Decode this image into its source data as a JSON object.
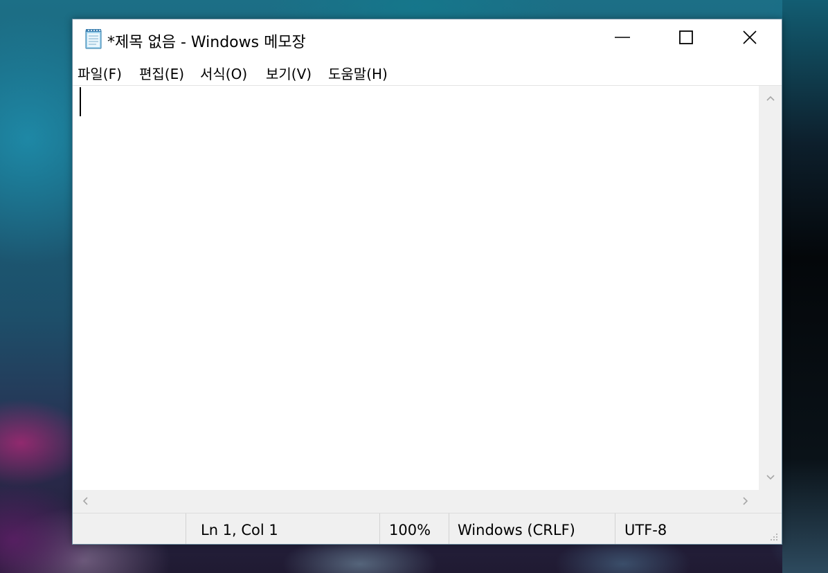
{
  "window": {
    "title": "*제목 없음 - Windows 메모장",
    "app_icon": "notepad-icon",
    "controls": {
      "minimize_icon": "minimize-icon",
      "maximize_icon": "maximize-icon",
      "close_icon": "close-icon"
    }
  },
  "menu": {
    "items": [
      {
        "label": "파일(F)"
      },
      {
        "label": "편집(E)"
      },
      {
        "label": "서식(O)"
      },
      {
        "label": "보기(V)"
      },
      {
        "label": "도움말(H)"
      }
    ]
  },
  "editor": {
    "content": ""
  },
  "status": {
    "position": "Ln 1, Col 1",
    "zoom": "100%",
    "line_ending": "Windows (CRLF)",
    "encoding": "UTF-8"
  },
  "colors": {
    "window_bg": "#ffffff",
    "chrome_bg": "#f0f0f0"
  }
}
